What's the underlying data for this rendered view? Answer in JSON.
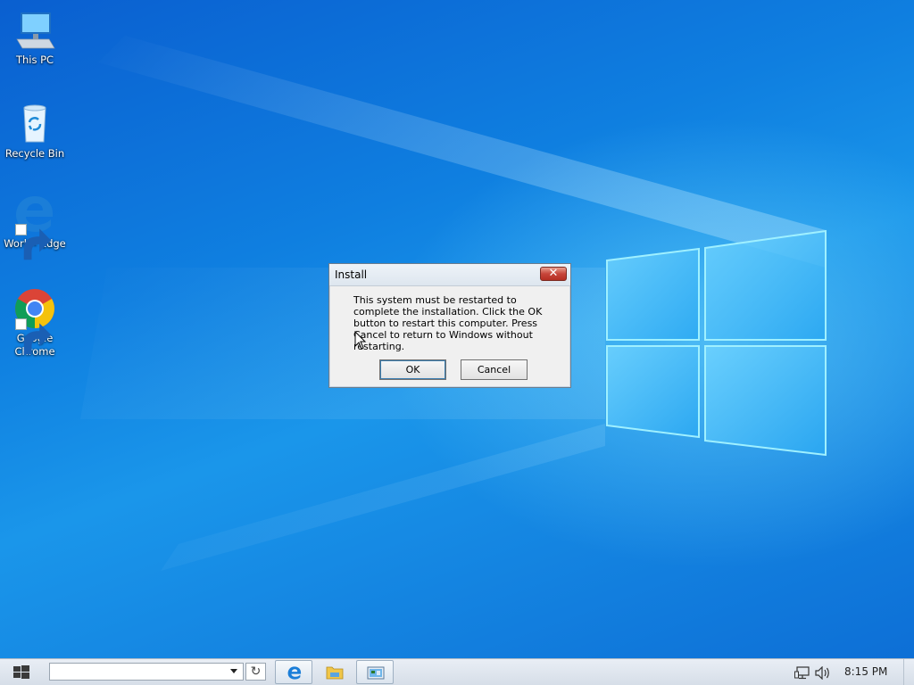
{
  "desktop": {
    "icons": [
      {
        "label": "This PC"
      },
      {
        "label": "Recycle Bin"
      },
      {
        "label": "Work - Edge"
      },
      {
        "label": "Google\nChrome"
      }
    ]
  },
  "dialog": {
    "title": "Install",
    "close_glyph": "✕",
    "message": "This system must be restarted to complete the installation. Click the OK button to restart this computer. Press Cancel to return to Windows without restarting.",
    "ok_label": "OK",
    "cancel_label": "Cancel"
  },
  "taskbar": {
    "search_value": "",
    "refresh_glyph": "↻",
    "apps": [
      {
        "icon": "edge-icon",
        "active": true
      },
      {
        "icon": "file-explorer-icon",
        "active": false
      },
      {
        "icon": "control-panel-icon",
        "active": true
      }
    ],
    "clock": "8:15 PM"
  },
  "colors": {
    "desktop_blue": "#0f7fe0",
    "close_red": "#c7453a",
    "taskbar_bg": "#dfe6ee"
  }
}
